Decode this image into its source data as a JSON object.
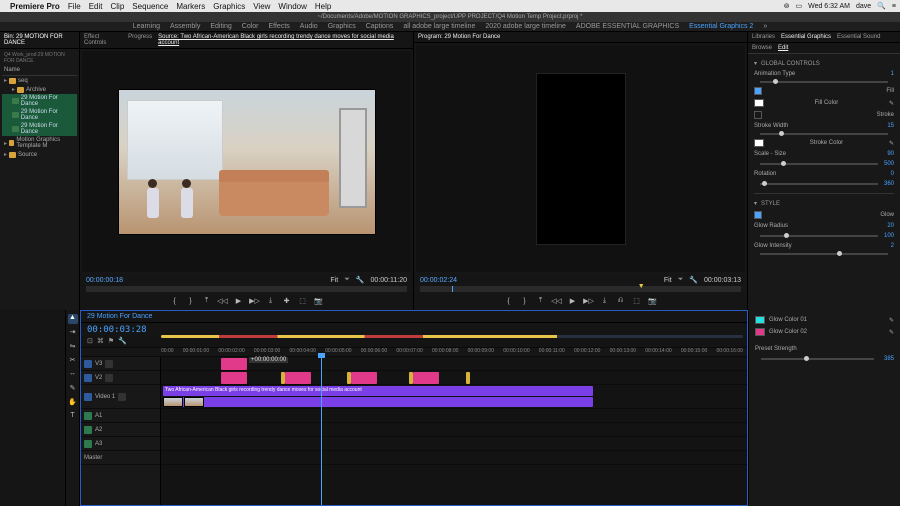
{
  "mac_menu": {
    "app": "Premiere Pro",
    "items": [
      "File",
      "Edit",
      "Clip",
      "Sequence",
      "Markers",
      "Graphics",
      "View",
      "Window",
      "Help"
    ],
    "clock": "Wed 6:32 AM",
    "user": "dave"
  },
  "titlebar": "~/Documents/Adobe/MOTION GRAPHICS_project/UPP PROJECT/Q4 Motion Temp Project.prproj *",
  "workspaces": {
    "items": [
      "Learning",
      "Assembly",
      "Editing",
      "Color",
      "Effects",
      "Audio",
      "Graphics",
      "Captions",
      "all adobe large timeline",
      "2020 adobe large timeline",
      "ADOBE ESSENTIAL GRAPHICS",
      "Essential Graphics 2"
    ],
    "active": "Essential Graphics 2",
    "overflow": "»"
  },
  "project_panel": {
    "bin_tab": "Bin: 29 MOTION FOR DANCE",
    "search_label": "Q4 Work_prod:29 MOTION FOR DANCE",
    "name_header": "Name",
    "items": [
      {
        "label": "seq",
        "type": "folder"
      },
      {
        "label": "Archive",
        "type": "folder"
      },
      {
        "label": "29 Motion For Dance",
        "type": "seq"
      },
      {
        "label": "29 Motion For Dance",
        "type": "seq"
      },
      {
        "label": "29 Motion For Dance",
        "type": "seq"
      },
      {
        "label": "Motion Graphics Template M",
        "type": "folder"
      },
      {
        "label": "Source",
        "type": "folder"
      }
    ]
  },
  "source_panel": {
    "tabs": [
      "Effect Controls",
      "Progress",
      "Source: Two African-American Black girls recording trendy dance moves for social media account"
    ],
    "active_tab": 2,
    "tc_in": "00:00:00:18",
    "fit": "Fit",
    "duration": "00:00:11:20"
  },
  "program_panel": {
    "tab": "Program: 29 Motion For Dance",
    "tc": "00:00:02:24",
    "fit": "Fit",
    "duration": "00:00:03:13"
  },
  "essential_graphics": {
    "top_tabs": [
      "Libraries",
      "Essential Graphics",
      "Essential Sound"
    ],
    "sub_tabs": [
      "Browse",
      "Edit"
    ],
    "sections": {
      "global": "GLOBAL CONTROLS",
      "animation_type": "Animation Type",
      "fill": "Fill",
      "fill_color": "Fill Color",
      "stroke": "Stroke",
      "stroke_width": "Stroke Width",
      "stroke_color": "Stroke Color",
      "scale": "Scale - Size",
      "rotation": "Rotation",
      "style": "STYLE",
      "glow": "Glow",
      "glow_radius": "Glow Radius",
      "glow_intensity": "Glow Intensity",
      "glow_color1": "Glow Color 01",
      "glow_color2": "Glow Color 02",
      "preset_strength": "Preset Strength"
    },
    "values": {
      "animation_type": "1",
      "stroke_width": "15",
      "scale": "90",
      "scale_max": "500",
      "rotation": "0",
      "rotation_max": "360",
      "glow_radius": "20",
      "glow_radius_max": "100",
      "glow_intensity": "2",
      "preset_strength": "385"
    },
    "colors": {
      "fill": "#ffffff",
      "stroke": "#ffffff",
      "glow1": "#26e0e0",
      "glow2": "#e03a8a"
    }
  },
  "timeline": {
    "tab": "29 Motion For Dance",
    "playhead_tc": "00:00:03:28",
    "ruler": [
      "00:00",
      "00:00:01:00",
      "00:00:02:00",
      "00:00:03:00",
      "00:00:04:00",
      "00:00:05:00",
      "00:00:06:00",
      "00:00:07:00",
      "00:00:08:00",
      "00:00:09:00",
      "00:00:10:00",
      "00:00:11:00",
      "00:00:12:00",
      "00:00:13:00",
      "00:00:14:00",
      "00:00:15:00",
      "00:00:16:00"
    ],
    "video_tracks": [
      "V3",
      "V2",
      "Video 1"
    ],
    "audio_tracks": [
      "A1",
      "A2",
      "A3",
      "Master"
    ],
    "clip_label_time": "+00:00:00:00",
    "clip_label_source": "Two African-American Black girls recording trendy dance moves for social media account"
  },
  "transport_icons": [
    "⎌",
    "⤒",
    "{",
    "◁◁",
    "◀",
    "▶",
    "▶▷",
    "}",
    "⤓",
    "✚",
    "↺",
    "⬚",
    "📷"
  ]
}
